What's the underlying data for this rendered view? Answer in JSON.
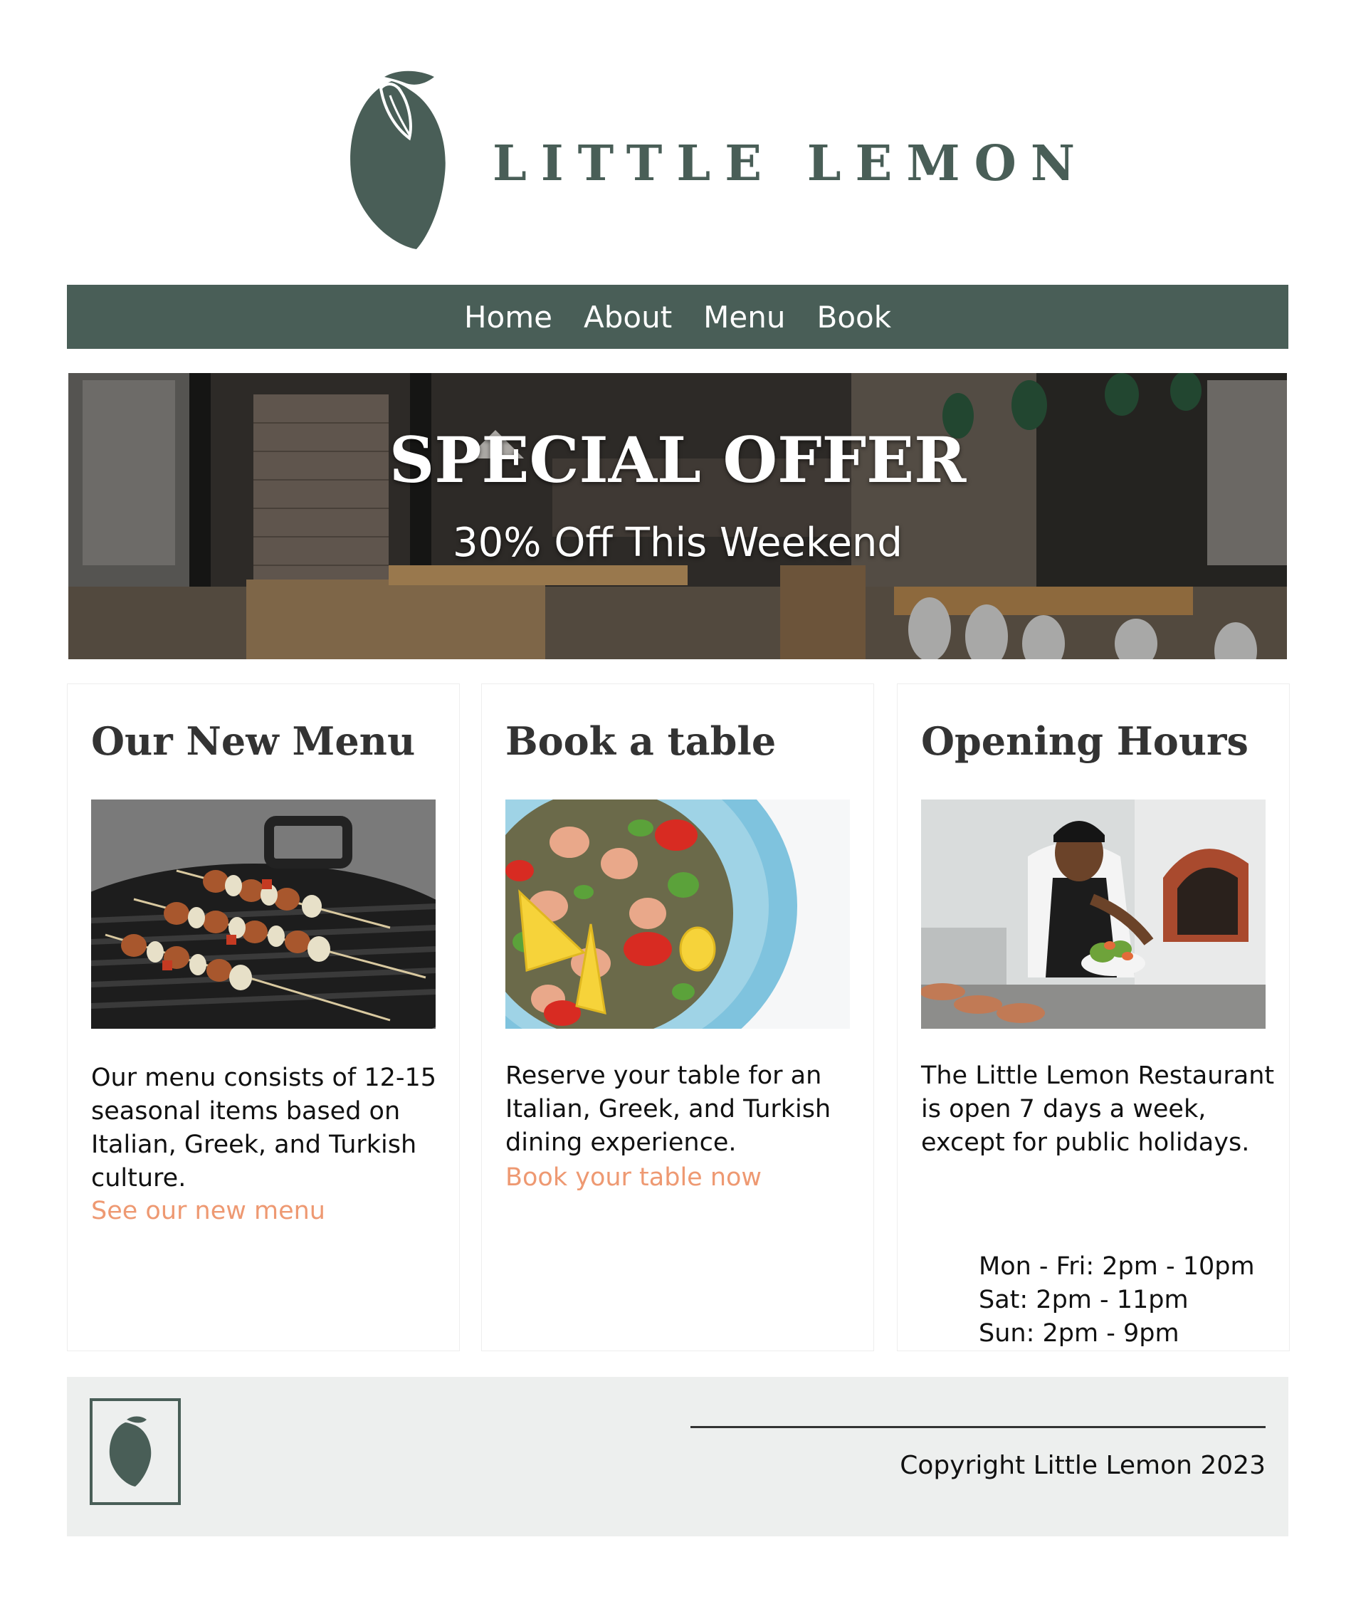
{
  "header": {
    "logo_text": "LITTLE LEMON"
  },
  "nav": {
    "items": [
      "Home",
      "About",
      "Menu",
      "Book"
    ]
  },
  "hero": {
    "title": "SPECIAL OFFER",
    "subtitle": "30% Off This Weekend"
  },
  "cards": [
    {
      "title": "Our New Menu",
      "text": "Our menu consists of 12-15 seasonal items based on Italian, Greek, and Turkish culture.",
      "link": "See our new menu"
    },
    {
      "title": "Book a table",
      "text": "Reserve your table for an Italian, Greek, and Turkish dining experience.",
      "link": "Book your table now"
    },
    {
      "title": "Opening Hours",
      "text": "The Little Lemon Restaurant is open 7 days a week, except for public holidays.",
      "hours": [
        "Mon - Fri: 2pm - 10pm",
        "Sat: 2pm - 11pm",
        "Sun: 2pm - 9pm"
      ]
    }
  ],
  "footer": {
    "copyright": "Copyright Little Lemon 2023"
  },
  "colors": {
    "brand_green": "#495e57",
    "link_salmon": "#ee9972",
    "footer_bg": "#edefee"
  }
}
